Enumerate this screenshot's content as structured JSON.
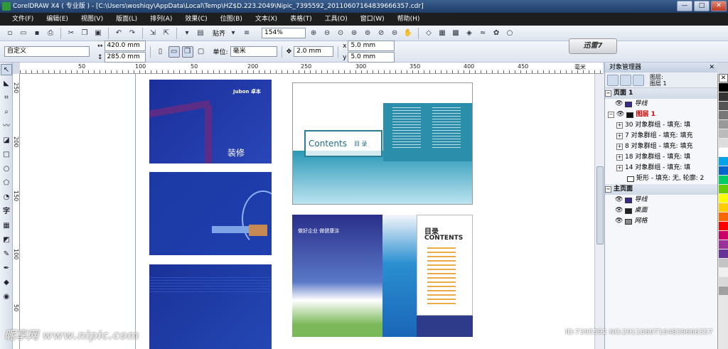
{
  "window": {
    "title": "CorelDRAW X4 ( 专业版 ) - [C:\\Users\\woshiqy\\AppData\\Local\\Temp\\HZ$D.223.2049\\Nipic_7395592_20110607164839666357.cdr]",
    "controls": [
      "—",
      "□",
      "✕"
    ]
  },
  "menu": [
    "文件(F)",
    "编辑(E)",
    "视图(V)",
    "版面(L)",
    "排列(A)",
    "效果(C)",
    "位图(B)",
    "文本(X)",
    "表格(T)",
    "工具(O)",
    "窗口(W)",
    "帮助(H)"
  ],
  "toolbar": {
    "snap_label": "贴齐",
    "zoom": "154%"
  },
  "propbar": {
    "preset": "自定义",
    "width": "420.0 mm",
    "height": "285.0 mm",
    "unit_label": "单位:",
    "unit": "毫米",
    "nudge": "2.0 mm",
    "dup_x": "5.0 mm",
    "dup_y": "5.0 mm"
  },
  "thunder": "迅雷7",
  "ruler": {
    "top": [
      "50",
      "100",
      "50",
      "200",
      "250",
      "300",
      "350",
      "400",
      "450",
      "毫米"
    ],
    "left": [
      "250",
      "200",
      "150",
      "100",
      "50"
    ]
  },
  "canvas": {
    "brochure1_brand": "Jubon 卓本",
    "brochure1_title": "装修",
    "contents_word": "Contents",
    "contents_cn": "目 录",
    "slogan": "做好企业 做健康涂",
    "toc_cn": "目录",
    "toc_en": "CONTENTS"
  },
  "docker": {
    "title": "对象管理器",
    "layer_label_1": "图层:",
    "layer_label_2": "图层 1",
    "items": [
      {
        "label": "页面 1",
        "type": "section"
      },
      {
        "label": "导线",
        "type": "layer",
        "color": "#3a2b8a"
      },
      {
        "label": "图层 1",
        "type": "layer-active",
        "color": "#cc0000"
      },
      {
        "label": "30 对象群组 - 填充: 填",
        "type": "group"
      },
      {
        "label": "7 对象群组 - 填充: 填充",
        "type": "group"
      },
      {
        "label": "8 对象群组 - 填充: 填充",
        "type": "group"
      },
      {
        "label": "18 对象群组 - 填充: 填",
        "type": "group"
      },
      {
        "label": "14 对象群组 - 填充: 填",
        "type": "group"
      },
      {
        "label": "矩形 - 填充: 无, 轮廓: 2",
        "type": "rect"
      },
      {
        "label": "主页面",
        "type": "section"
      },
      {
        "label": "导线",
        "type": "layer",
        "color": "#3a2b8a"
      },
      {
        "label": "桌面",
        "type": "layer",
        "color": "#222222"
      },
      {
        "label": "网格",
        "type": "layer",
        "color": "#888888"
      }
    ]
  },
  "palette": [
    "#ffffff",
    "#000000",
    "#3a3a3a",
    "#5a5a5a",
    "#777777",
    "#999999",
    "#bbbbbb",
    "#dddddd",
    "#ffffff",
    "#e6e6e6",
    "#cccccc",
    "#00a2e8",
    "#0066cc",
    "#00cc66",
    "#66cc00",
    "#ffff00",
    "#ffcc00",
    "#ff6600",
    "#ff0000",
    "#cc0066",
    "#993399",
    "#663399",
    "#c4c4c4",
    "#f0f0f0",
    "#d8d8d8",
    "#a0a0a0",
    "#777777",
    "#555555"
  ],
  "watermark": "昵享网 www.nipic.com",
  "id_stamp": "ID:7395592 NO:20110607164839666357"
}
